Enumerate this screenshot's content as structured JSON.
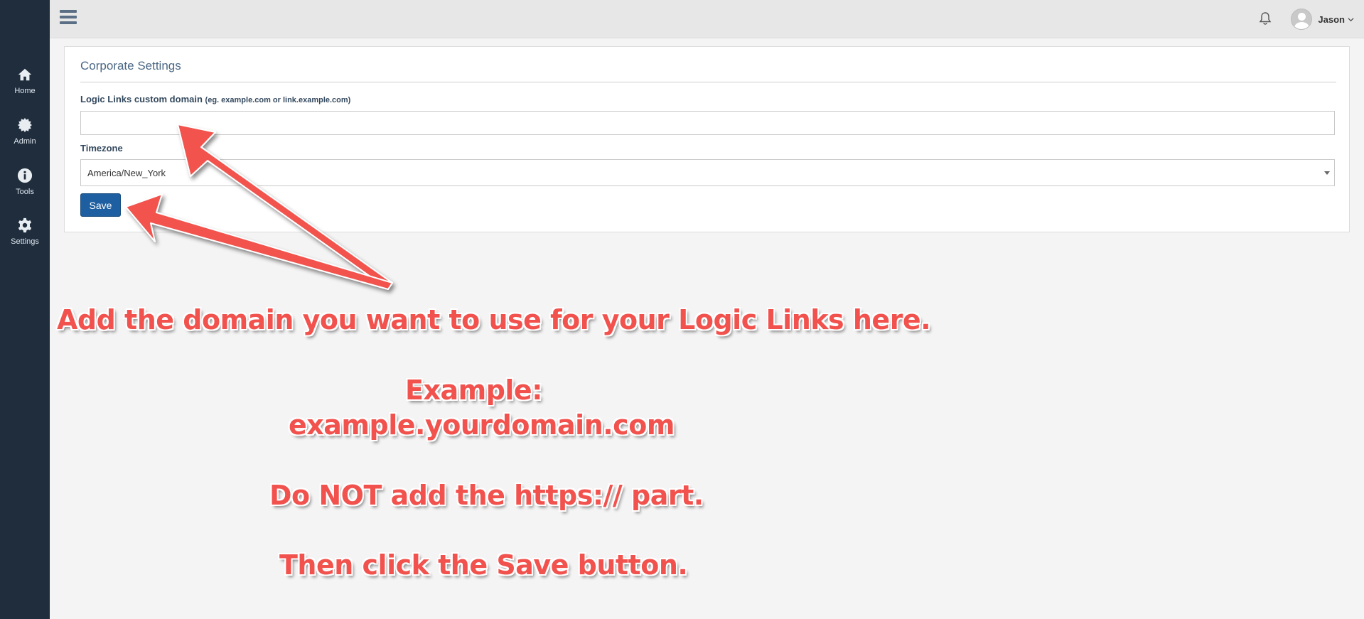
{
  "sidebar": {
    "items": [
      {
        "label": "Home",
        "icon": "home-icon"
      },
      {
        "label": "Admin",
        "icon": "gear-burst-icon"
      },
      {
        "label": "Tools",
        "icon": "info-icon"
      },
      {
        "label": "Settings",
        "icon": "gear-icon"
      }
    ]
  },
  "header": {
    "user_name": "Jason"
  },
  "panel": {
    "title": "Corporate Settings",
    "domain_label": "Logic Links custom domain",
    "domain_hint": "(eg. example.com or link.example.com)",
    "domain_value": "",
    "timezone_label": "Timezone",
    "timezone_value": "America/New_York",
    "save_label": "Save"
  },
  "annotation": {
    "line1": "Add the domain you want to use for your Logic Links here.",
    "line2": "Example:",
    "line3": "example.yourdomain.com",
    "line4": "Do NOT add the https:// part.",
    "line5": "Then click the Save button.",
    "color": "#f2524d"
  },
  "colors": {
    "sidebar_bg": "#1f2d3d",
    "header_bg": "#e7e7e7",
    "button_bg": "#1d5fa0",
    "title_color": "#4a6784"
  }
}
